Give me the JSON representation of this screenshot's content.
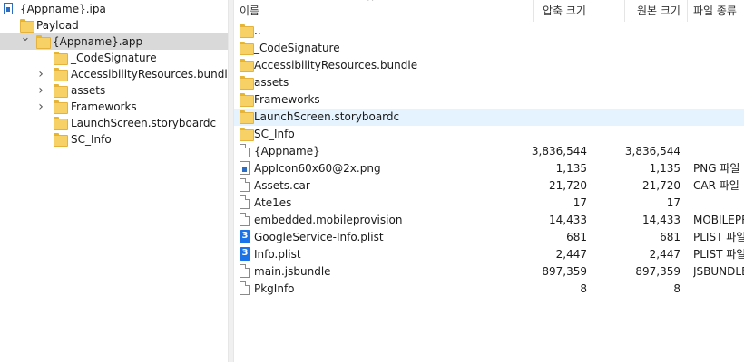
{
  "tree": [
    {
      "label": "{Appname}.ipa",
      "icon": "archive-icon",
      "arrow": ""
    },
    {
      "label": "Payload",
      "icon": "folder-icon",
      "arrow": ""
    },
    {
      "label": "{Appname}.app",
      "icon": "folder-icon",
      "arrow": "⌄",
      "selected": true
    },
    {
      "label": "_CodeSignature",
      "icon": "folder-icon",
      "arrow": ""
    },
    {
      "label": "AccessibilityResources.bundle",
      "icon": "folder-icon",
      "arrow": "›"
    },
    {
      "label": "assets",
      "icon": "folder-icon",
      "arrow": "›"
    },
    {
      "label": "Frameworks",
      "icon": "folder-icon",
      "arrow": "›"
    },
    {
      "label": "LaunchScreen.storyboardc",
      "icon": "folder-icon",
      "arrow": ""
    },
    {
      "label": "SC_Info",
      "icon": "folder-icon",
      "arrow": ""
    }
  ],
  "columns": {
    "name": "이름",
    "compressed": "압축 크기",
    "original": "원본 크기",
    "type": "파일 종류"
  },
  "sort_indicator": "^",
  "files": [
    {
      "name": "..",
      "icon": "folder-icon",
      "compressed": "",
      "original": "",
      "type": ""
    },
    {
      "name": "_CodeSignature",
      "icon": "folder-icon",
      "compressed": "",
      "original": "",
      "type": ""
    },
    {
      "name": "AccessibilityResources.bundle",
      "icon": "folder-icon",
      "compressed": "",
      "original": "",
      "type": ""
    },
    {
      "name": "assets",
      "icon": "folder-icon",
      "compressed": "",
      "original": "",
      "type": ""
    },
    {
      "name": "Frameworks",
      "icon": "folder-icon",
      "compressed": "",
      "original": "",
      "type": ""
    },
    {
      "name": "LaunchScreen.storyboardc",
      "icon": "folder-icon",
      "compressed": "",
      "original": "",
      "type": "",
      "highlighted": true
    },
    {
      "name": "SC_Info",
      "icon": "folder-icon",
      "compressed": "",
      "original": "",
      "type": ""
    },
    {
      "name": "{Appname}",
      "icon": "file-icon",
      "compressed": "3,836,544",
      "original": "3,836,544",
      "type": ""
    },
    {
      "name": "AppIcon60x60@2x.png",
      "icon": "image-file-icon",
      "compressed": "1,135",
      "original": "1,135",
      "type": "PNG 파일"
    },
    {
      "name": "Assets.car",
      "icon": "file-icon",
      "compressed": "21,720",
      "original": "21,720",
      "type": "CAR 파일"
    },
    {
      "name": "Ate1es",
      "icon": "file-icon",
      "compressed": "17",
      "original": "17",
      "type": ""
    },
    {
      "name": "embedded.mobileprovision",
      "icon": "file-icon",
      "compressed": "14,433",
      "original": "14,433",
      "type": "MOBILEPR"
    },
    {
      "name": "GoogleService-Info.plist",
      "icon": "plist-icon",
      "compressed": "681",
      "original": "681",
      "type": "PLIST 파일"
    },
    {
      "name": "Info.plist",
      "icon": "plist-icon",
      "compressed": "2,447",
      "original": "2,447",
      "type": "PLIST 파일"
    },
    {
      "name": "main.jsbundle",
      "icon": "file-icon",
      "compressed": "897,359",
      "original": "897,359",
      "type": "JSBUNDLE"
    },
    {
      "name": "PkgInfo",
      "icon": "file-icon",
      "compressed": "8",
      "original": "8",
      "type": ""
    }
  ],
  "plist_glyph": "3"
}
